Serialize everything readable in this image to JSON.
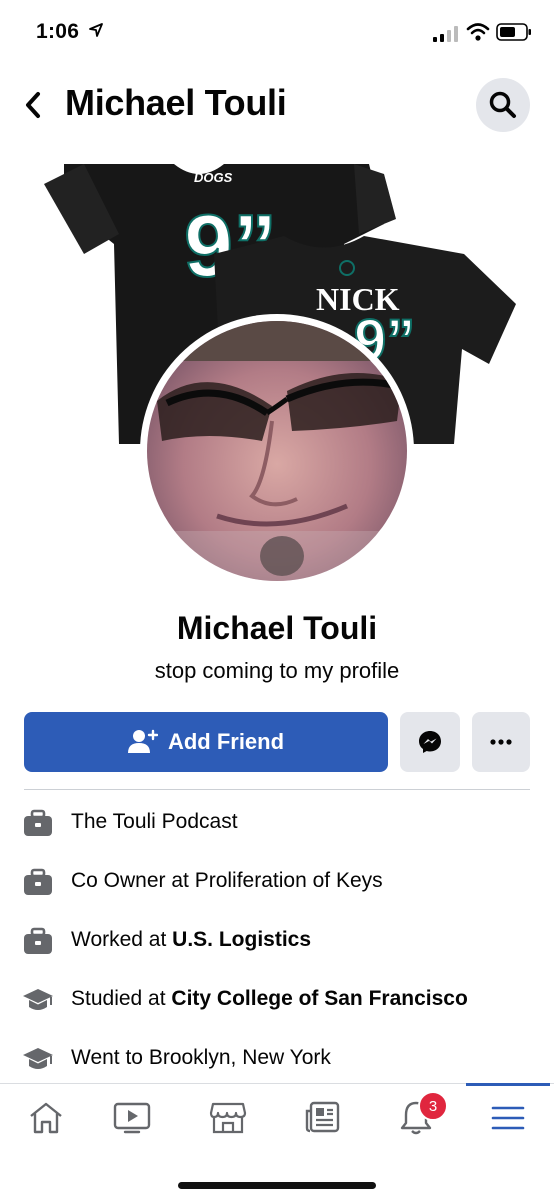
{
  "status_bar": {
    "time": "1:06"
  },
  "header": {
    "title": "Michael Touli"
  },
  "cover": {
    "shirt_brand": "DOGS",
    "shirt_number": "9”",
    "shirt_name": "NICK"
  },
  "profile": {
    "name": "Michael Touli",
    "bio": "stop coming to my profile"
  },
  "actions": {
    "add_friend_label": "Add Friend"
  },
  "info": [
    {
      "icon": "briefcase-icon",
      "prefix": "The Touli Podcast",
      "bold": ""
    },
    {
      "icon": "briefcase-icon",
      "prefix": "Co Owner at Proliferation of Keys",
      "bold": ""
    },
    {
      "icon": "briefcase-icon",
      "prefix": "Worked at ",
      "bold": "U.S. Logistics"
    },
    {
      "icon": "graduation-cap-icon",
      "prefix": "Studied at ",
      "bold": "City College of San Francisco"
    },
    {
      "icon": "graduation-cap-icon",
      "prefix": "Went to Brooklyn, New York",
      "bold": ""
    }
  ],
  "tab_bar": {
    "tabs": [
      "home-icon",
      "watch-icon",
      "marketplace-icon",
      "news-icon",
      "notifications-icon",
      "menu-icon"
    ],
    "notifications_badge": "3",
    "active_tab": "menu-icon",
    "accent": "#2d5cb7"
  },
  "colors": {
    "primary": "#2d5cb7",
    "badge": "#e0263e",
    "secondary_bg": "#e4e6eb"
  }
}
